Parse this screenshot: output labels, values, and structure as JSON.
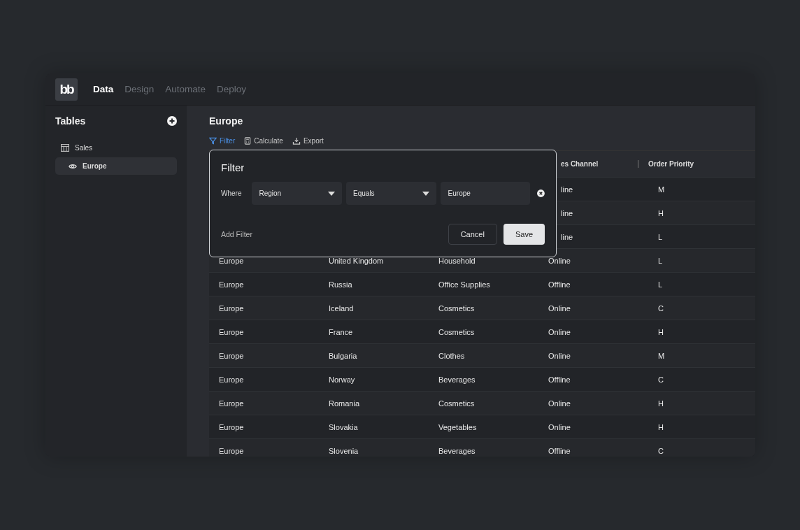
{
  "logo": "bb",
  "nav": [
    {
      "label": "Data",
      "selected": true
    },
    {
      "label": "Design",
      "selected": false
    },
    {
      "label": "Automate",
      "selected": false
    },
    {
      "label": "Deploy",
      "selected": false
    }
  ],
  "sidebar": {
    "title": "Tables",
    "items": [
      {
        "label": "Sales",
        "kind": "table",
        "selected": false
      },
      {
        "label": "Europe",
        "kind": "view",
        "selected": true
      }
    ]
  },
  "main": {
    "title": "Europe",
    "toolbar": [
      {
        "label": "Filter",
        "kind": "filter",
        "selected": true
      },
      {
        "label": "Calculate",
        "kind": "calculate",
        "selected": false
      },
      {
        "label": "Export",
        "kind": "export",
        "selected": false
      }
    ]
  },
  "table": {
    "columns": [
      "es Channel",
      "Order Priority"
    ],
    "rows": [
      {
        "kind": "covered",
        "cells": [
          "line",
          "M"
        ]
      },
      {
        "kind": "covered",
        "cells": [
          "line",
          "H"
        ]
      },
      {
        "kind": "covered",
        "cells": [
          "line",
          "L"
        ]
      },
      {
        "kind": "full",
        "cells": [
          "Europe",
          "United Kingdom",
          "Household",
          "Online",
          "L"
        ]
      },
      {
        "kind": "full",
        "cells": [
          "Europe",
          "Russia",
          "Office Supplies",
          "Offline",
          "L"
        ]
      },
      {
        "kind": "full",
        "cells": [
          "Europe",
          "Iceland",
          "Cosmetics",
          "Online",
          "C"
        ]
      },
      {
        "kind": "full",
        "cells": [
          "Europe",
          "France",
          "Cosmetics",
          "Online",
          "H"
        ]
      },
      {
        "kind": "full",
        "cells": [
          "Europe",
          "Bulgaria",
          "Clothes",
          "Online",
          "M"
        ]
      },
      {
        "kind": "full",
        "cells": [
          "Europe",
          "Norway",
          "Beverages",
          "Offline",
          "C"
        ]
      },
      {
        "kind": "full",
        "cells": [
          "Europe",
          "Romania",
          "Cosmetics",
          "Online",
          "H"
        ]
      },
      {
        "kind": "full",
        "cells": [
          "Europe",
          "Slovakia",
          "Vegetables",
          "Online",
          "H"
        ]
      },
      {
        "kind": "full",
        "cells": [
          "Europe",
          "Slovenia",
          "Beverages",
          "Offline",
          "C"
        ]
      }
    ]
  },
  "filter_popover": {
    "title": "Filter",
    "where": "Where",
    "field": "Region",
    "operator": "Equals",
    "value": "Europe",
    "add": "Add Filter",
    "cancel": "Cancel",
    "save": "Save"
  }
}
